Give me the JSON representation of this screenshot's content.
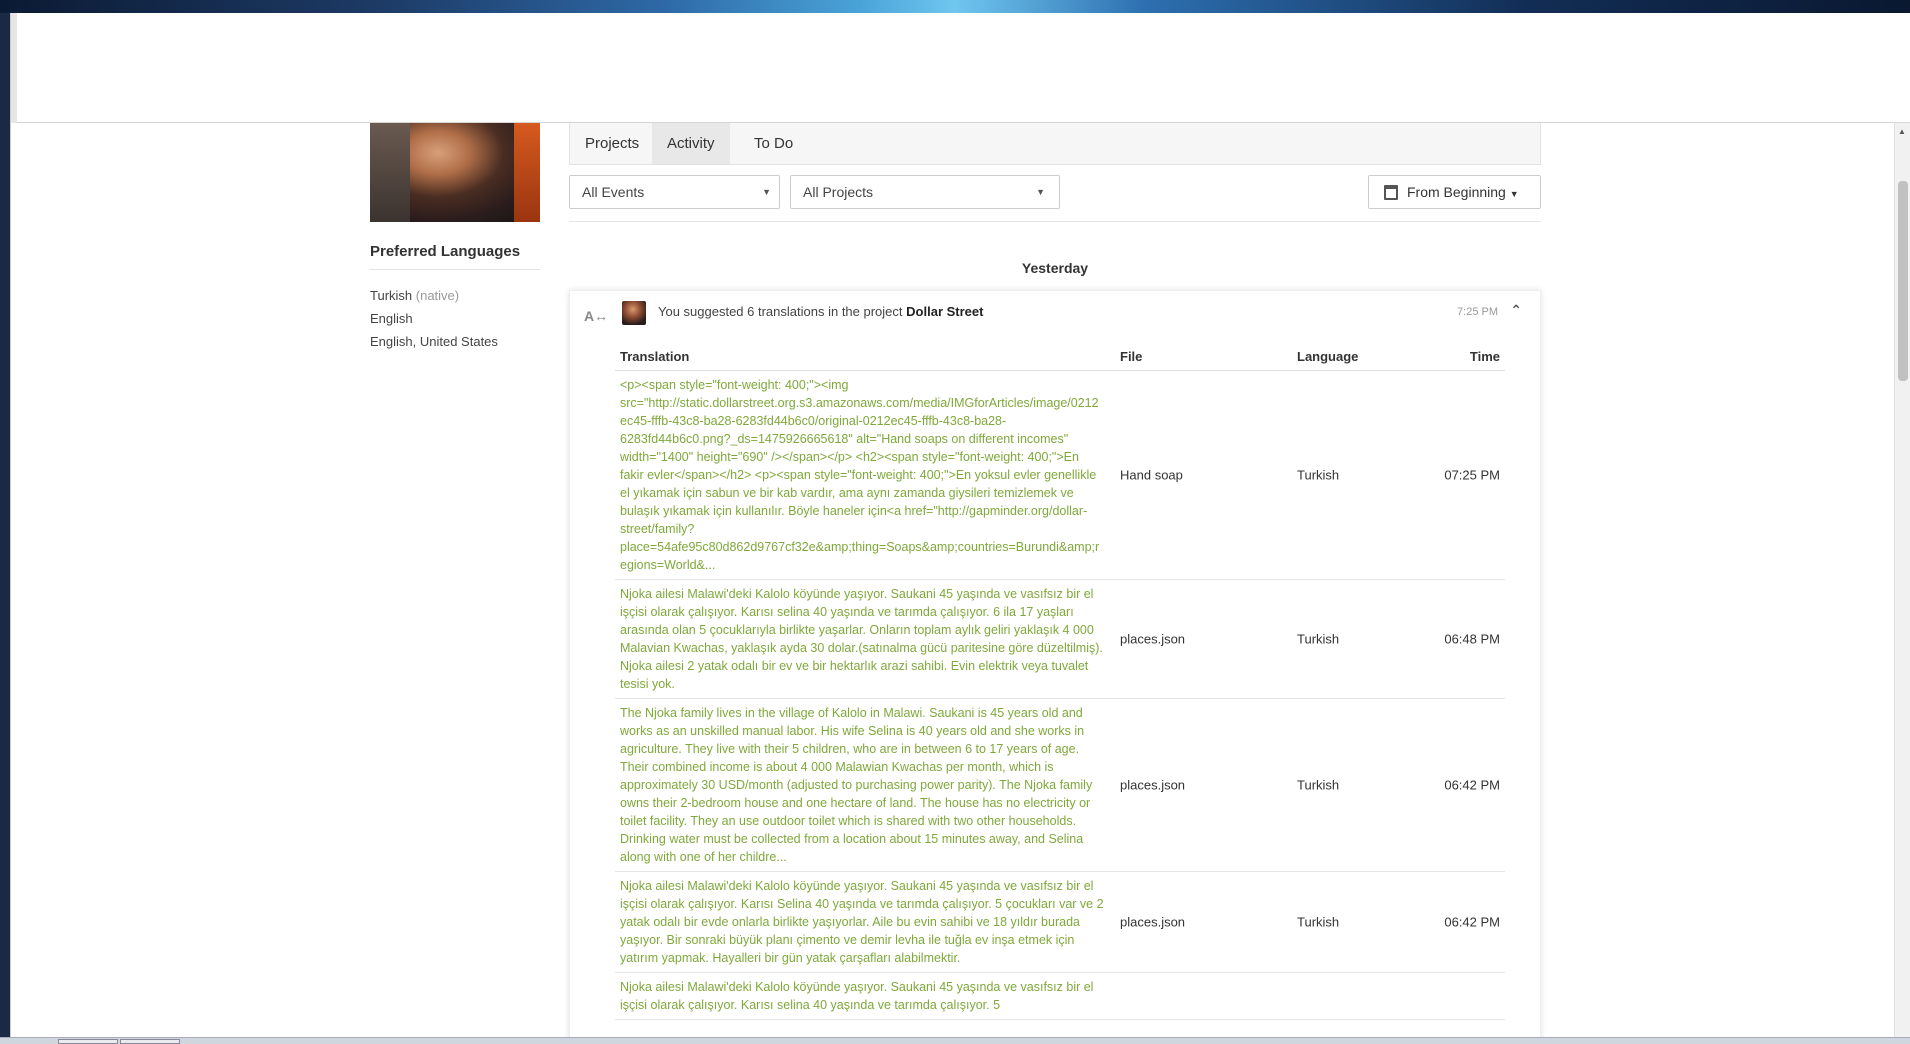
{
  "tabs": [
    "Projects",
    "Activity",
    "To Do"
  ],
  "filters": {
    "events": "All Events",
    "projects": "All Projects",
    "date": "From Beginning"
  },
  "profile": {
    "preferred_title": "Preferred Languages",
    "languages": [
      {
        "name": "Turkish",
        "note": "(native)"
      },
      {
        "name": "English",
        "note": ""
      },
      {
        "name": "English, United States",
        "note": ""
      }
    ]
  },
  "day_label": "Yesterday",
  "event": {
    "text_prefix": "You suggested 6 translations in the project",
    "project": "Dollar Street",
    "time": "7:25 PM"
  },
  "table": {
    "headers": {
      "translation": "Translation",
      "file": "File",
      "language": "Language",
      "time": "Time"
    },
    "rows": [
      {
        "translation": "<p><span style=\"font-weight: 400;\"><img src=\"http://static.dollarstreet.org.s3.amazonaws.com/media/IMGforArticles/image/0212ec45-fffb-43c8-ba28-6283fd44b6c0/original-0212ec45-fffb-43c8-ba28-6283fd44b6c0.png?_ds=1475926665618\" alt=\"Hand soaps on different incomes\" width=\"1400\" height=\"690\" /></span></p> <h2><span style=\"font-weight: 400;\">En fakir evler</span></h2> <p><span style=\"font-weight: 400;\">En yoksul evler genellikle el yıkamak için sabun ve bir kab vardır, ama aynı zamanda giysileri temizlemek ve bulaşık yıkamak için kullanılır. Böyle haneler için<a href=\"http://gapminder.org/dollar-street/family?place=54afe95c80d862d9767cf32e&amp;thing=Soaps&amp;countries=Burundi&amp;regions=World&...",
        "file": "Hand soap",
        "language": "Turkish",
        "time": "07:25 PM"
      },
      {
        "translation": "Njoka ailesi Malawi'deki Kalolo köyünde yaşıyor. Saukani 45 yaşında ve vasıfsız bir el işçisi olarak çalışıyor. Karısı selina 40 yaşında ve tarımda çalışıyor. 6 ila 17 yaşları arasında olan 5 çocuklarıyla birlikte yaşarlar. Onların toplam aylık geliri yaklaşık 4 000 Malavian Kwachas, yaklaşık ayda 30 dolar.(satınalma gücü paritesine göre düzeltilmiş). Njoka ailesi 2 yatak odalı bir ev ve bir hektarlık arazi sahibi. Evin elektrik veya tuvalet tesisi yok.",
        "file": "places.json",
        "language": "Turkish",
        "time": "06:48 PM"
      },
      {
        "translation": "The Njoka family lives in the village of Kalolo in Malawi. Saukani is 45 years old and works as an unskilled manual labor. His wife Selina is 40 years old and she works in agriculture. They live with their 5 children, who are in between 6 to 17 years of age. Their combined income is about 4 000 Malawian Kwachas per month, which is approximately 30 USD/month (adjusted to purchasing power parity). The Njoka family owns their 2-bedroom house and one hectare of land. The house has no electricity or toilet facility. They an use outdoor toilet which is shared with two other households. Drinking water must be collected from a location about 15 minutes away, and Selina along with one of her childre...",
        "file": "places.json",
        "language": "Turkish",
        "time": "06:42 PM"
      },
      {
        "translation": "Njoka ailesi Malawi'deki Kalolo köyünde yaşıyor. Saukani 45 yaşında ve vasıfsız bir el işçisi olarak çalışıyor. Karısı Selina 40 yaşında ve tarımda çalışıyor. 5 çocukları var ve 2 yatak odalı bir evde onlarla birlikte yaşıyorlar. Aile bu evin sahibi ve 18 yıldır burada yaşıyor. Bir sonraki büyük planı çimento ve demir levha ile tuğla ev inşa etmek için yatırım yapmak. Hayalleri bir gün yatak çarşafları alabilmektir.",
        "file": "places.json",
        "language": "Turkish",
        "time": "06:42 PM"
      },
      {
        "translation": "Njoka ailesi Malawi'deki Kalolo köyünde yaşıyor. Saukani 45 yaşında ve vasıfsız bir el işçisi olarak çalışıyor. Karısı selina 40 yaşında ve tarımda çalışıyor. 5",
        "file": "",
        "language": "",
        "time": ""
      }
    ]
  }
}
